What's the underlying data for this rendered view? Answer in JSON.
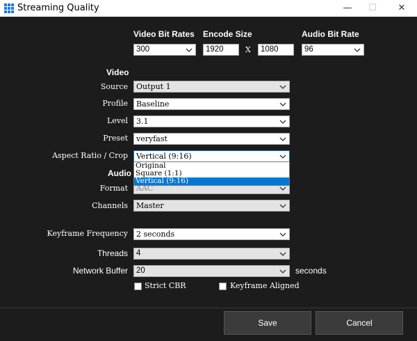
{
  "window": {
    "title": "Streaming Quality",
    "minimize": "—",
    "maximize": "☐",
    "close": "✕"
  },
  "video_header": {
    "bitrates_label": "Video Bit Rates",
    "encode_size_label": "Encode Size",
    "audio_bitrate_label": "Audio Bit Rate",
    "bitrate_value": "300",
    "width_value": "1920",
    "x_separator": "X",
    "height_value": "1080",
    "audio_bitrate_value": "96"
  },
  "video": {
    "section_label": "Video",
    "source_label": "Source",
    "source_value": "Output 1",
    "profile_label": "Profile",
    "profile_value": "Baseline",
    "level_label": "Level",
    "level_value": "3.1",
    "preset_label": "Preset",
    "preset_value": "veryfast",
    "aspect_label": "Aspect Ratio / Crop",
    "aspect_value": "Vertical (9:16)",
    "aspect_options": [
      "Original",
      "Square (1:1)",
      "Vertical (9:16)"
    ]
  },
  "audio": {
    "section_label": "Audio",
    "format_label": "Format",
    "format_value": "AAC",
    "channels_label": "Channels",
    "channels_value": "Master"
  },
  "advanced": {
    "keyframe_label": "Keyframe Frequency",
    "keyframe_value": "2 seconds",
    "threads_label": "Threads",
    "threads_value": "4",
    "network_buffer_label": "Network Buffer",
    "network_buffer_value": "20",
    "network_buffer_unit": "seconds",
    "strict_cbr_label": "Strict CBR",
    "keyframe_aligned_label": "Keyframe Aligned"
  },
  "footer": {
    "save_label": "Save",
    "cancel_label": "Cancel"
  },
  "colors": {
    "background": "#1c1c1c",
    "accent": "#0078d7",
    "button": "#3b3b3b"
  }
}
